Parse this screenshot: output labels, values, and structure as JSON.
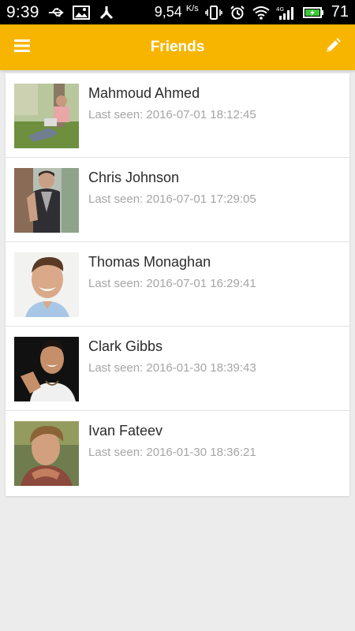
{
  "status_bar": {
    "time": "9:39",
    "speed": "9,54",
    "speed_unit": "K/s",
    "network": "4G",
    "battery": "71"
  },
  "app_bar": {
    "title": "Friends",
    "menu_icon": "menu-icon",
    "edit_icon": "edit-icon"
  },
  "friends": [
    {
      "name": "Mahmoud Ahmed",
      "last_seen": "Last seen: 2016-07-01 18:12:45"
    },
    {
      "name": "Chris Johnson",
      "last_seen": "Last seen: 2016-07-01 17:29:05"
    },
    {
      "name": "Thomas Monaghan",
      "last_seen": "Last seen: 2016-07-01 16:29:41"
    },
    {
      "name": "Clark Gibbs",
      "last_seen": "Last seen: 2016-01-30 18:39:43"
    },
    {
      "name": "Ivan Fateev",
      "last_seen": "Last seen: 2016-01-30 18:36:21"
    }
  ],
  "colors": {
    "accent": "#f7b500",
    "background": "#ececec",
    "status_bar": "#000000"
  }
}
